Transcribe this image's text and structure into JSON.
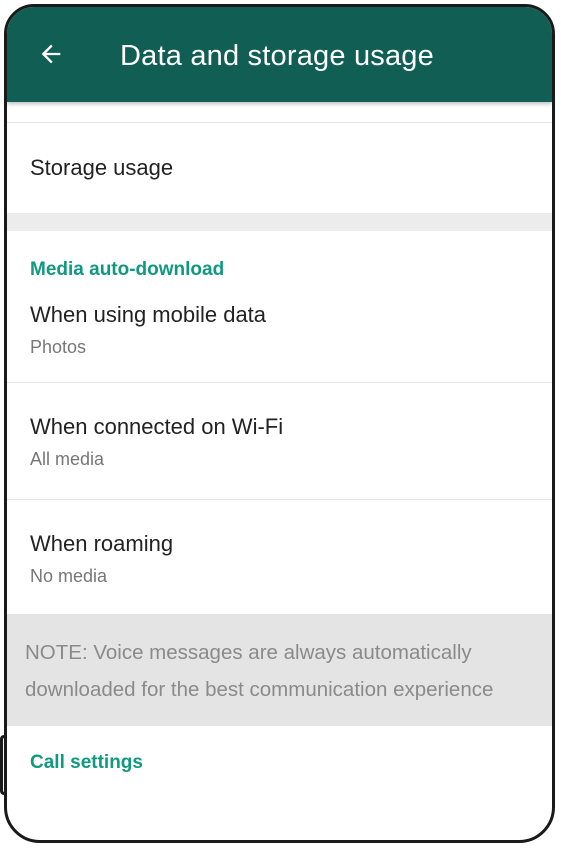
{
  "appbar": {
    "title": "Data and storage usage",
    "back_icon": "arrow-left-icon",
    "color": "#115e54"
  },
  "storage": {
    "label": "Storage usage"
  },
  "media_auto_download": {
    "header": "Media auto-download",
    "accent_color": "#0f9a80",
    "items": [
      {
        "title": "When using mobile data",
        "value": "Photos"
      },
      {
        "title": "When connected on Wi-Fi",
        "value": "All media"
      },
      {
        "title": "When roaming",
        "value": "No media"
      }
    ]
  },
  "note": {
    "text": "NOTE: Voice messages are always automatically downloaded for the best communication experience"
  },
  "call_settings": {
    "header": "Call settings"
  }
}
